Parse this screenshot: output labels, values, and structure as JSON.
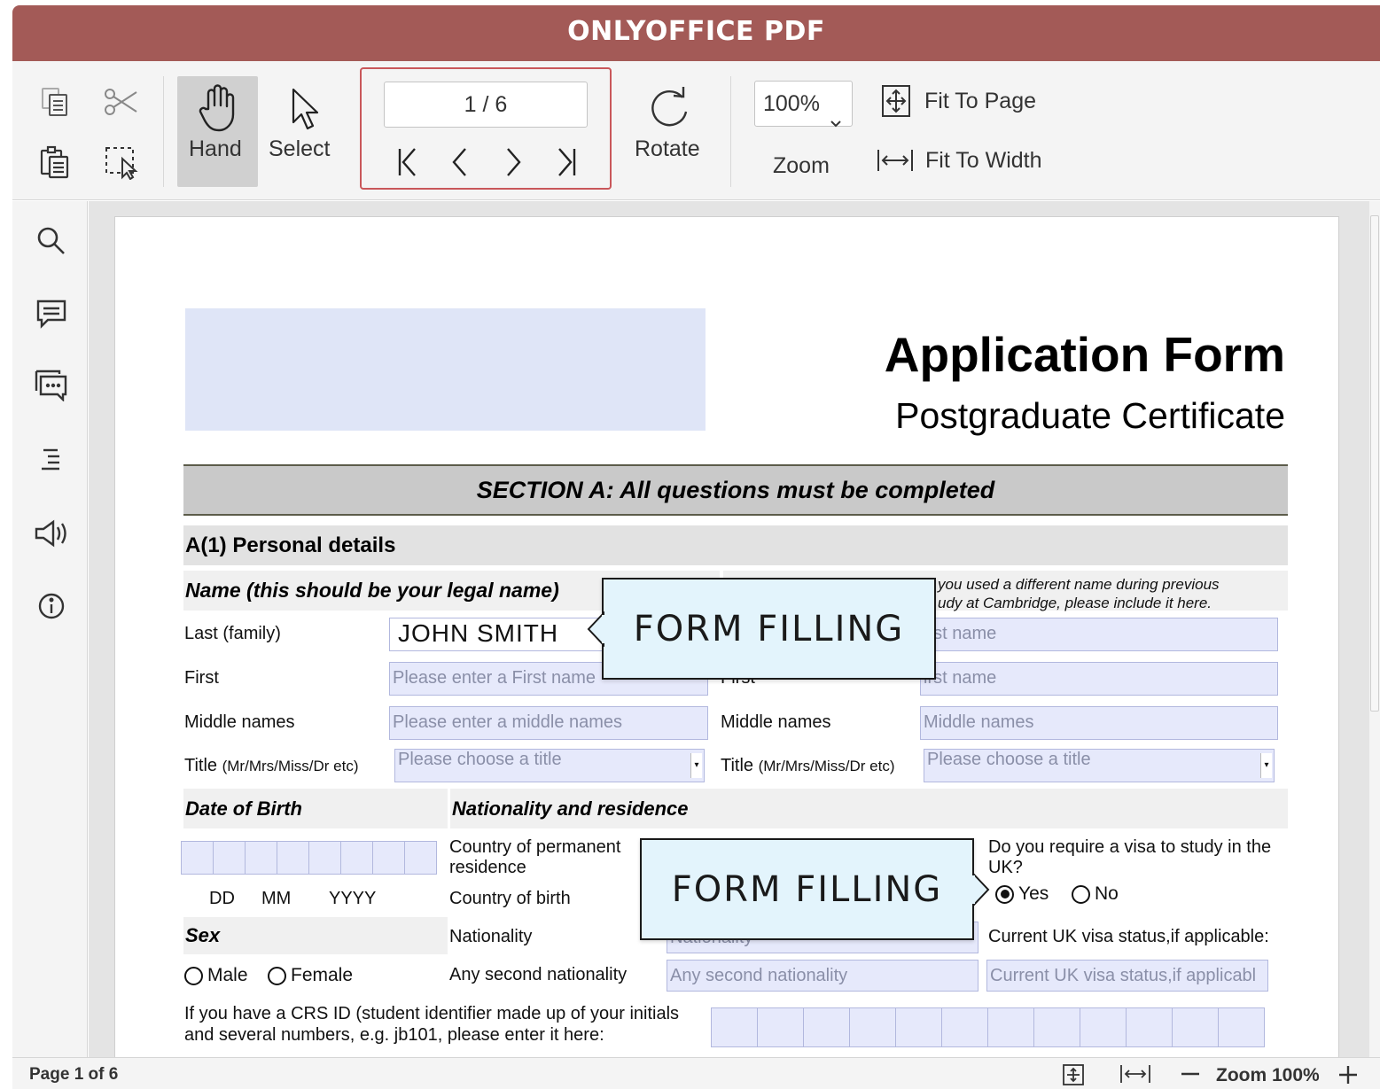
{
  "app": {
    "title": "ONLYOFFICE PDF"
  },
  "toolbar": {
    "hand_label": "Hand",
    "select_label": "Select",
    "page_field": "1 / 6",
    "rotate_label": "Rotate",
    "zoom_value": "100%",
    "zoom_label": "Zoom",
    "fit_page_label": "Fit To Page",
    "fit_width_label": "Fit To Width",
    "icons": [
      "copy-icon",
      "cut-icon",
      "paste-icon",
      "select-area-icon",
      "hand-icon",
      "pointer-icon",
      "first-page-icon",
      "prev-page-icon",
      "next-page-icon",
      "last-page-icon",
      "rotate-icon",
      "fit-page-icon",
      "fit-width-icon"
    ]
  },
  "sidebar": {
    "icons": [
      "search-icon",
      "comment-icon",
      "chat-icon",
      "headings-icon",
      "feedback-icon",
      "info-icon"
    ]
  },
  "form": {
    "title": "Application Form",
    "subtitle": "Postgraduate Certificate",
    "section_title": "SECTION A: All questions must be completed",
    "personal_header": "A(1) Personal details",
    "name_header": "Name (this should be your legal name)",
    "prev_name_note_line1": "you used a different name during previous",
    "prev_name_note_line2": "udy at Cambridge, please include it here.",
    "labels": {
      "last": "Last (family)",
      "first": "First",
      "middle": "Middle names",
      "title": "Title",
      "title_hint": "(Mr/Mrs/Miss/Dr etc)",
      "first_right": "First",
      "middle_right": "Middle names",
      "title_right": "Title",
      "title_hint_right": "(Mr/Mrs/Miss/Dr etc)"
    },
    "fields": {
      "last_value": "JOHN SMITH",
      "first_placeholder": "Please enter a First name",
      "middle_placeholder": "Please enter a middle names",
      "title_placeholder": "Please choose a title",
      "prev_last_placeholder": "ast name",
      "prev_first_placeholder": "irst name",
      "prev_middle_placeholder": "Middle names",
      "prev_title_placeholder": "Please choose a title"
    },
    "dob_header": "Date of Birth",
    "dob_parts": {
      "dd": "DD",
      "mm": "MM",
      "yyyy": "YYYY"
    },
    "sex_header": "Sex",
    "sex_options": {
      "male": "Male",
      "female": "Female"
    },
    "nationality_header": "Nationality and residence",
    "residence_label_line1": "Country of permanent",
    "residence_label_line2": "residence",
    "birth_label": "Country of birth",
    "nationality_label": "Nationality",
    "nationality_placeholder": "Nationality",
    "second_nationality_label": "Any second nationality",
    "second_nationality_placeholder": "Any second nationality",
    "visa_question_line1": "Do you require a visa to study in the",
    "visa_question_line2": "UK?",
    "visa_options": {
      "yes": "Yes",
      "no": "No",
      "selected": "Yes"
    },
    "visa_status_label": "Current UK visa status,if applicable:",
    "visa_status_placeholder": "Current UK visa status,if applicabl",
    "crs_line1": "If you have a CRS ID (student identifier made up of your initials",
    "crs_line2": "and several numbers, e.g. jb101, please enter it here:"
  },
  "callouts": [
    "FORM FILLING",
    "FORM FILLING"
  ],
  "status": {
    "page_info": "Page 1 of 6",
    "zoom_label": "Zoom 100%"
  }
}
